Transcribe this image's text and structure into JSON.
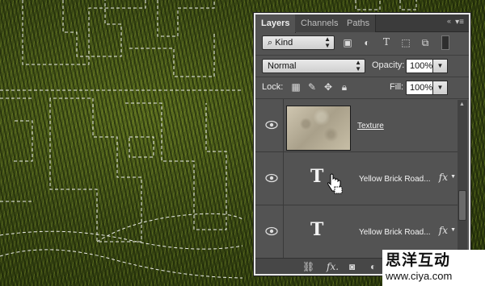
{
  "panel": {
    "tabs": [
      {
        "label": "Layers",
        "active": true
      },
      {
        "label": "Channels",
        "active": false
      },
      {
        "label": "Paths",
        "active": false
      }
    ],
    "filter": {
      "kind_label": "Kind"
    },
    "blend_mode": "Normal",
    "opacity": {
      "label": "Opacity:",
      "value": "100%"
    },
    "lock": {
      "label": "Lock:"
    },
    "fill": {
      "label": "Fill:",
      "value": "100%"
    },
    "layers": [
      {
        "name": "Texture",
        "type": "image",
        "visible": true
      },
      {
        "name": "Yellow Brick Road...",
        "type": "text",
        "visible": true,
        "fx": "fx"
      },
      {
        "name": "Yellow Brick Road...",
        "type": "text",
        "visible": true,
        "fx": "fx"
      }
    ],
    "footer_icons": [
      "link-icon",
      "fx-icon",
      "mask-icon",
      "adjustment-icon"
    ]
  },
  "watermark": {
    "title": "思洋互动",
    "url": "www.ciya.com"
  },
  "colors": {
    "panel_bg": "#535353",
    "tab_bar": "#3b3b3b",
    "border": "#e8e8e8"
  }
}
